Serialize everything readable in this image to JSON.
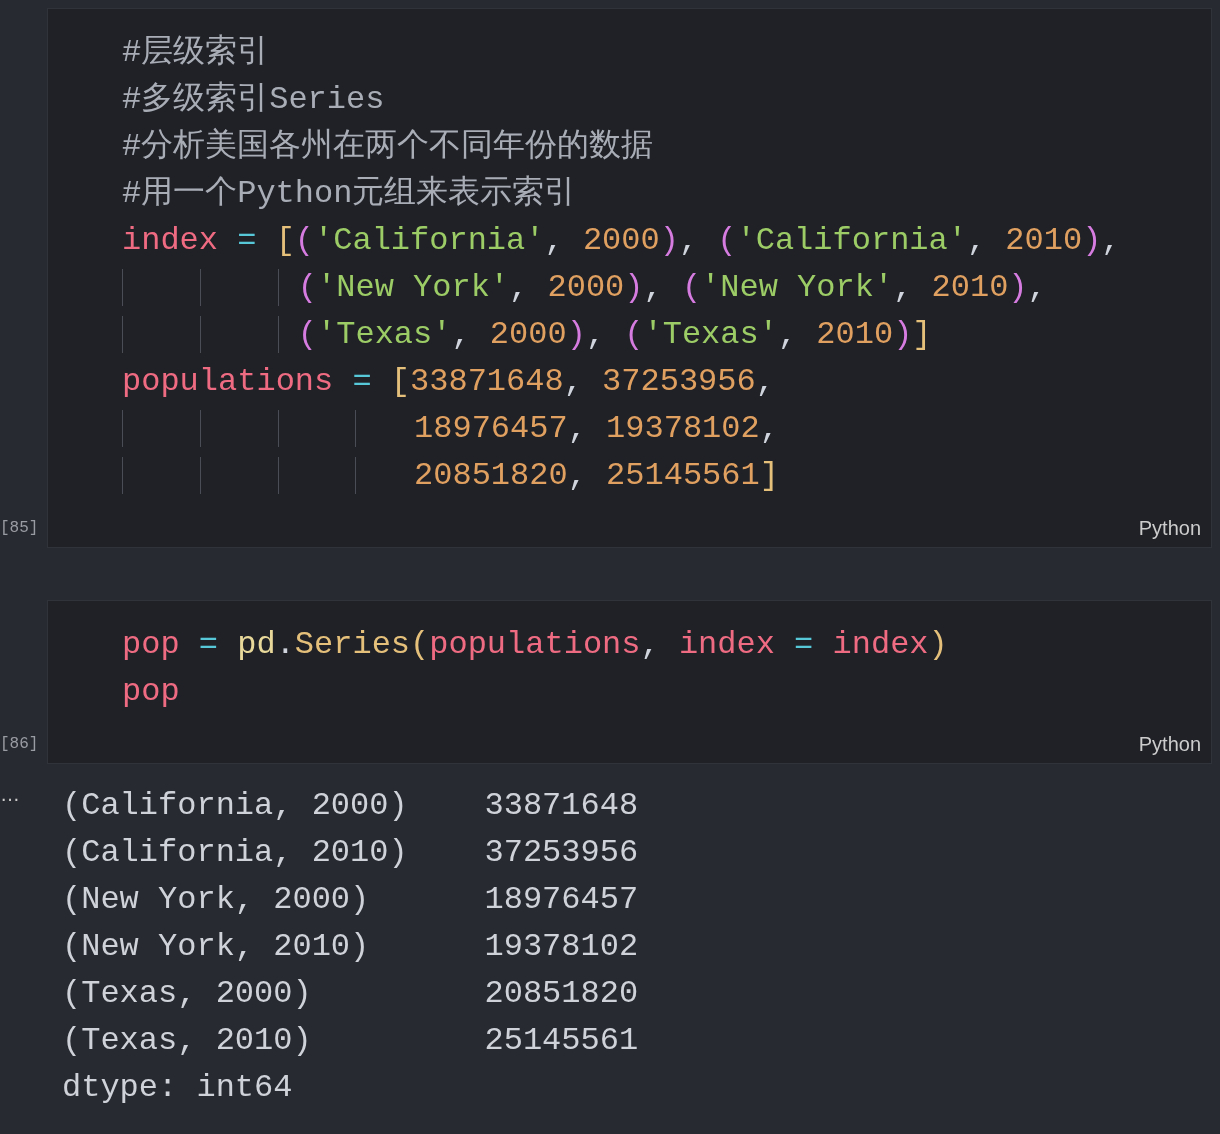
{
  "cells": [
    {
      "execution_count": "[85]",
      "language": "Python",
      "lines": [
        [
          {
            "text": "#层级索引",
            "kind": "comment"
          }
        ],
        [
          {
            "text": "#多级索引Series",
            "kind": "comment"
          }
        ],
        [
          {
            "text": "#分析美国各州在两个不同年份的数据",
            "kind": "comment"
          }
        ],
        [
          {
            "text": "#用一个Python元组来表示索引",
            "kind": "comment"
          }
        ],
        [
          {
            "text": "index",
            "kind": "var"
          },
          {
            "text": " = ",
            "kind": "op"
          },
          {
            "text": "[",
            "kind": "bracket"
          },
          {
            "text": "(",
            "kind": "paren"
          },
          {
            "text": "'California'",
            "kind": "string"
          },
          {
            "text": ", ",
            "kind": "punct"
          },
          {
            "text": "2000",
            "kind": "number"
          },
          {
            "text": ")",
            "kind": "paren"
          },
          {
            "text": ", ",
            "kind": "punct"
          },
          {
            "text": "(",
            "kind": "paren"
          },
          {
            "text": "'California'",
            "kind": "string"
          },
          {
            "text": ", ",
            "kind": "punct"
          },
          {
            "text": "2010",
            "kind": "number"
          },
          {
            "text": ")",
            "kind": "paren"
          },
          {
            "text": ",",
            "kind": "punct"
          }
        ],
        [
          {
            "text": "         (",
            "kind": "paren"
          },
          {
            "text": "'New York'",
            "kind": "string"
          },
          {
            "text": ", ",
            "kind": "punct"
          },
          {
            "text": "2000",
            "kind": "number"
          },
          {
            "text": ")",
            "kind": "paren"
          },
          {
            "text": ", ",
            "kind": "punct"
          },
          {
            "text": "(",
            "kind": "paren"
          },
          {
            "text": "'New York'",
            "kind": "string"
          },
          {
            "text": ", ",
            "kind": "punct"
          },
          {
            "text": "2010",
            "kind": "number"
          },
          {
            "text": ")",
            "kind": "paren"
          },
          {
            "text": ",",
            "kind": "punct"
          }
        ],
        [
          {
            "text": "         (",
            "kind": "paren"
          },
          {
            "text": "'Texas'",
            "kind": "string"
          },
          {
            "text": ", ",
            "kind": "punct"
          },
          {
            "text": "2000",
            "kind": "number"
          },
          {
            "text": ")",
            "kind": "paren"
          },
          {
            "text": ", ",
            "kind": "punct"
          },
          {
            "text": "(",
            "kind": "paren"
          },
          {
            "text": "'Texas'",
            "kind": "string"
          },
          {
            "text": ", ",
            "kind": "punct"
          },
          {
            "text": "2010",
            "kind": "number"
          },
          {
            "text": ")",
            "kind": "paren"
          },
          {
            "text": "]",
            "kind": "bracket"
          }
        ],
        [
          {
            "text": "populations",
            "kind": "var"
          },
          {
            "text": " = ",
            "kind": "op"
          },
          {
            "text": "[",
            "kind": "bracket"
          },
          {
            "text": "33871648",
            "kind": "number"
          },
          {
            "text": ", ",
            "kind": "punct"
          },
          {
            "text": "37253956",
            "kind": "number"
          },
          {
            "text": ",",
            "kind": "punct"
          }
        ],
        [
          {
            "text": "               18976457",
            "kind": "number"
          },
          {
            "text": ", ",
            "kind": "punct"
          },
          {
            "text": "19378102",
            "kind": "number"
          },
          {
            "text": ",",
            "kind": "punct"
          }
        ],
        [
          {
            "text": "               20851820",
            "kind": "number"
          },
          {
            "text": ", ",
            "kind": "punct"
          },
          {
            "text": "25145561",
            "kind": "number"
          },
          {
            "text": "]",
            "kind": "bracket"
          }
        ]
      ]
    },
    {
      "execution_count": "[86]",
      "language": "Python",
      "lines": [
        [
          {
            "text": "pop",
            "kind": "var"
          },
          {
            "text": " = ",
            "kind": "op"
          },
          {
            "text": "pd",
            "kind": "module"
          },
          {
            "text": ".",
            "kind": "punct"
          },
          {
            "text": "Series",
            "kind": "func"
          },
          {
            "text": "(",
            "kind": "bracket"
          },
          {
            "text": "populations",
            "kind": "var"
          },
          {
            "text": ", ",
            "kind": "punct"
          },
          {
            "text": "index",
            "kind": "var"
          },
          {
            "text": " = ",
            "kind": "op"
          },
          {
            "text": "index",
            "kind": "var"
          },
          {
            "text": ")",
            "kind": "bracket"
          }
        ],
        [
          {
            "text": "pop",
            "kind": "var"
          }
        ]
      ],
      "output": {
        "marker": "…",
        "lines": [
          "(California, 2000)    33871648",
          "(California, 2010)    37253956",
          "(New York, 2000)      18976457",
          "(New York, 2010)      19378102",
          "(Texas, 2000)         20851820",
          "(Texas, 2010)         25145561",
          "dtype: int64"
        ]
      }
    }
  ]
}
